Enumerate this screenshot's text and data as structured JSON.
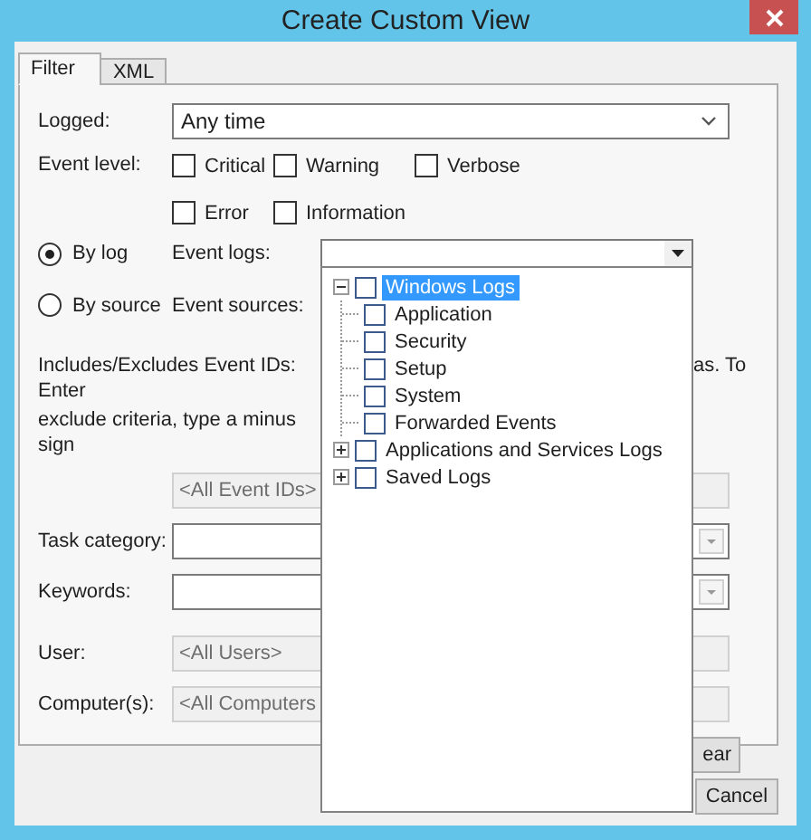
{
  "window": {
    "title": "Create Custom View"
  },
  "tabs": [
    {
      "label": "Filter",
      "selected": true
    },
    {
      "label": "XML",
      "selected": false
    }
  ],
  "filter": {
    "logged": {
      "label": "Logged:",
      "value": "Any time"
    },
    "event_level": {
      "label": "Event level:",
      "options": [
        {
          "label": "Critical",
          "checked": false
        },
        {
          "label": "Warning",
          "checked": false
        },
        {
          "label": "Verbose",
          "checked": false
        },
        {
          "label": "Error",
          "checked": false
        },
        {
          "label": "Information",
          "checked": false
        }
      ]
    },
    "log_filter": [
      {
        "label": "By log",
        "selected": true
      },
      {
        "label": "By source",
        "selected": false
      }
    ],
    "event_logs": {
      "label": "Event logs:",
      "tree": [
        {
          "label": "Windows Logs",
          "checked": false,
          "selected": true,
          "expanded": true,
          "children": [
            {
              "label": "Application",
              "checked": false,
              "selected": false
            },
            {
              "label": "Security",
              "checked": false,
              "selected": false
            },
            {
              "label": "Setup",
              "checked": false,
              "selected": false
            },
            {
              "label": "System",
              "checked": false,
              "selected": false
            },
            {
              "label": "Forwarded Events",
              "checked": false,
              "selected": false
            }
          ]
        },
        {
          "label": "Applications and Services Logs",
          "checked": false,
          "selected": false,
          "expanded": false
        },
        {
          "label": "Saved Logs",
          "checked": false,
          "selected": false,
          "expanded": false
        }
      ]
    },
    "event_sources": {
      "label": "Event sources:"
    },
    "event_ids": {
      "hint_line_1": "Includes/Excludes Event IDs: Enter",
      "hint_line_1_end": "as. To",
      "hint_line_2": "exclude criteria, type a minus sign",
      "placeholder": "<All Event IDs>"
    },
    "task_category": {
      "label": "Task category:"
    },
    "keywords": {
      "label": "Keywords:"
    },
    "user": {
      "label": "User:",
      "placeholder": "<All Users>"
    },
    "computers": {
      "label": "Computer(s):",
      "placeholder": "<All Computers"
    },
    "clear_button": "ear"
  },
  "buttons": [
    "Cancel"
  ]
}
